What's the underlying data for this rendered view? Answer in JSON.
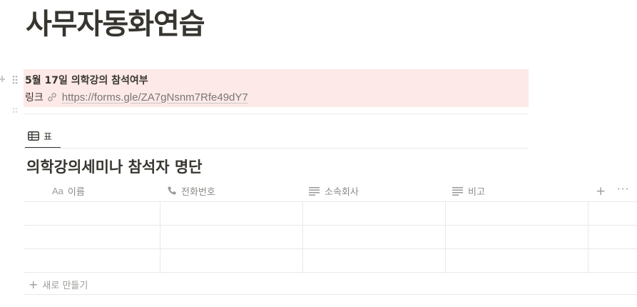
{
  "page": {
    "title": "사무자동화연습"
  },
  "callout": {
    "title": "5월 17일 의학강의 참석여부",
    "link_label": "링크",
    "link_url": "https://forms.gle/ZA7gNsnm7Rfe49dY7",
    "background": "#fde9e8"
  },
  "view_tabs": [
    {
      "label": "표",
      "icon": "table-icon"
    }
  ],
  "database": {
    "title": "의학강의세미나 참석자 명단",
    "columns": [
      {
        "label": "이름",
        "icon": "Aa"
      },
      {
        "label": "전화번호",
        "icon": "phone-icon"
      },
      {
        "label": "소속회사",
        "icon": "text-lines-icon"
      },
      {
        "label": "비고",
        "icon": "text-lines-icon"
      }
    ],
    "add_column": "+",
    "more": "···",
    "rows": [
      [
        "",
        "",
        "",
        ""
      ],
      [
        "",
        "",
        "",
        ""
      ],
      [
        "",
        "",
        "",
        ""
      ]
    ],
    "new_row_label": "새로 만들기"
  }
}
